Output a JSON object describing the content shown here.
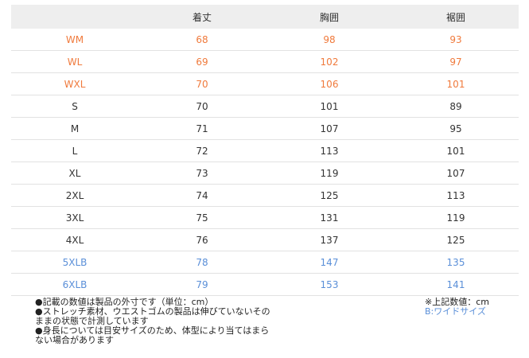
{
  "table": {
    "headers": [
      "",
      "着丈",
      "胸囲",
      "裾囲"
    ],
    "rows": [
      {
        "size": "WM",
        "length": "68",
        "chest": "98",
        "hem": "93",
        "tone": "orange"
      },
      {
        "size": "WL",
        "length": "69",
        "chest": "102",
        "hem": "97",
        "tone": "orange"
      },
      {
        "size": "WXL",
        "length": "70",
        "chest": "106",
        "hem": "101",
        "tone": "orange"
      },
      {
        "size": "S",
        "length": "70",
        "chest": "101",
        "hem": "89",
        "tone": "normal"
      },
      {
        "size": "M",
        "length": "71",
        "chest": "107",
        "hem": "95",
        "tone": "normal"
      },
      {
        "size": "L",
        "length": "72",
        "chest": "113",
        "hem": "101",
        "tone": "normal"
      },
      {
        "size": "XL",
        "length": "73",
        "chest": "119",
        "hem": "107",
        "tone": "normal"
      },
      {
        "size": "2XL",
        "length": "74",
        "chest": "125",
        "hem": "113",
        "tone": "normal"
      },
      {
        "size": "3XL",
        "length": "75",
        "chest": "131",
        "hem": "119",
        "tone": "normal"
      },
      {
        "size": "4XL",
        "length": "76",
        "chest": "137",
        "hem": "125",
        "tone": "normal"
      },
      {
        "size": "5XLB",
        "length": "78",
        "chest": "147",
        "hem": "135",
        "tone": "blue"
      },
      {
        "size": "6XLB",
        "length": "79",
        "chest": "153",
        "hem": "141",
        "tone": "blue"
      }
    ]
  },
  "notes": [
    "●記載の数値は製品の外寸です（単位：cm）",
    "●ストレッチ素材、ウエストゴムの製品は伸びていないそのままの状態で計測しています",
    "●身長については目安サイズのため、体型により当てはまらない場合があります"
  ],
  "side_notes": {
    "unit": "※上記数値：cm",
    "wide": "B:ワイドサイズ"
  },
  "colors": {
    "orange": "#f07a3c",
    "blue": "#5a8fd8",
    "header_bg": "#eeeeee"
  }
}
